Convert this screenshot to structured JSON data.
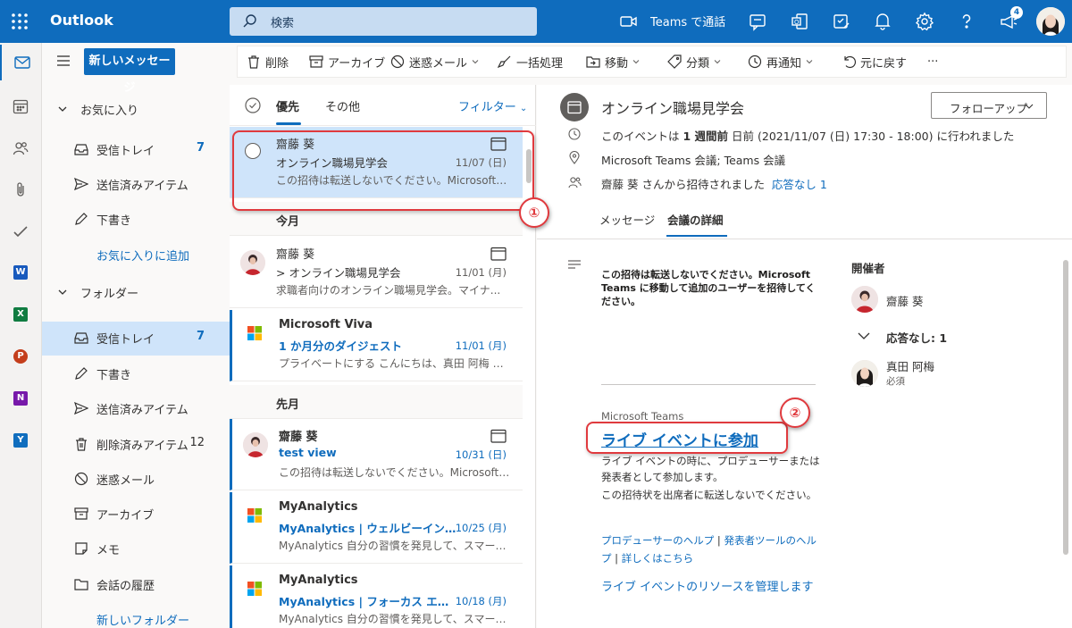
{
  "header": {
    "app_name": "Outlook",
    "search_placeholder": "検索",
    "teams_call_label": "Teams で通話",
    "notification_count": "4",
    "accent": "#0f6cbd"
  },
  "rail": {
    "items": [
      "mail-icon",
      "calendar-icon",
      "people-icon",
      "attach-icon",
      "todo-icon",
      "word-icon",
      "excel-icon",
      "powerpoint-icon",
      "onenote-icon",
      "yammer-icon"
    ],
    "app_tiles": [
      {
        "letter": "W",
        "color": "#185abd"
      },
      {
        "letter": "X",
        "color": "#107c41"
      },
      {
        "letter": "P",
        "color": "#c43e1c"
      },
      {
        "letter": "N",
        "color": "#7719aa"
      },
      {
        "letter": "Y",
        "color": "#106ebe"
      }
    ]
  },
  "folders": {
    "new_message": "新しいメッセージ",
    "favorites_label": "お気に入り",
    "favorites": [
      {
        "label": "受信トレイ",
        "count": "7"
      },
      {
        "label": "送信済みアイテム",
        "count": ""
      },
      {
        "label": "下書き",
        "count": ""
      }
    ],
    "add_favorite": "お気に入りに追加",
    "folders_label": "フォルダー",
    "items": [
      {
        "label": "受信トレイ",
        "count": "7"
      },
      {
        "label": "下書き",
        "count": ""
      },
      {
        "label": "送信済みアイテム",
        "count": ""
      },
      {
        "label": "削除済みアイテム",
        "count": "12"
      },
      {
        "label": "迷惑メール",
        "count": ""
      },
      {
        "label": "アーカイブ",
        "count": ""
      },
      {
        "label": "メモ",
        "count": ""
      },
      {
        "label": "会話の履歴",
        "count": ""
      }
    ],
    "new_folder": "新しいフォルダー"
  },
  "toolbar": {
    "delete": "削除",
    "archive": "アーカイブ",
    "junk": "迷惑メール",
    "sweep": "一括処理",
    "move": "移動",
    "categorize": "分類",
    "snooze": "再通知",
    "undo": "元に戻す",
    "more": "···"
  },
  "list": {
    "tab_focused": "優先",
    "tab_other": "その他",
    "filter": "フィルター",
    "group_this_month": "今月",
    "group_last_month": "先月",
    "messages": [
      {
        "sender": "齋藤 葵",
        "subject": "オンライン職場見学会",
        "date": "11/07 (日)",
        "preview": "この招待は転送しないでください。Microsoft T..."
      },
      {
        "sender": "齋藤 葵",
        "subject": "> オンライン職場見学会",
        "date": "11/01 (月)",
        "preview": "求職者向けのオンライン職場見学会。マイナ..."
      },
      {
        "sender": "Microsoft Viva",
        "subject": "1 か月分のダイジェスト",
        "date": "11/01 (月)",
        "preview": "プライベートにする こんにちは、真田 阿梅 さん ..."
      },
      {
        "sender": "齋藤 葵",
        "subject": "test view",
        "date": "10/31 (日)",
        "preview": "この招待は転送しないでください。Microsoft T..."
      },
      {
        "sender": "MyAnalytics",
        "subject": "MyAnalytics | ウェルビーイング ...",
        "date": "10/25 (月)",
        "preview": "MyAnalytics 自分の習慣を発見して、スマート..."
      },
      {
        "sender": "MyAnalytics",
        "subject": "MyAnalytics | フォーカス エディ...",
        "date": "10/18 (月)",
        "preview": "MyAnalytics 自分の習慣を発見して、スマート..."
      }
    ]
  },
  "reading": {
    "title": "オンライン職場見学会",
    "follow_up": "フォローアップ",
    "when_prefix": "このイベントは ",
    "when_bold": "1 週間前",
    "when_suffix": " 日前 (2021/11/07 (日) 17:30 - 18:00) に行われました",
    "location": "Microsoft Teams 会議; Teams 会議",
    "invited_by": "齋藤 葵 さんから招待されました",
    "no_response": "応答なし 1",
    "tab_message": "メッセージ",
    "tab_details": "会議の詳細",
    "body": "この招待は転送しないでください。Microsoft Teams に移動して追加のユーザーを招待してください。",
    "teams_label": "Microsoft Teams",
    "join_link": "ライブ イベントに参加",
    "para1": "ライブ イベントの時に、プロデューサーまたは発表者として参加します。",
    "para2": "この招待状を出席者に転送しないでください。",
    "link1": "プロデューサーのヘルプ",
    "sep1": " | ",
    "link2": "発表者ツールのヘルプ",
    "sep2": " | ",
    "link3": "詳しくはこちら",
    "manage": "ライブ イベントのリソースを管理します",
    "organizer_heading": "開催者",
    "organizer": "齋藤 葵",
    "no_response_count": "応答なし: 1",
    "attendee": "真田 阿梅",
    "attendee_role": "必須"
  },
  "annotations": {
    "marker1": "①",
    "marker2": "②",
    "color": "#e03a3e"
  }
}
